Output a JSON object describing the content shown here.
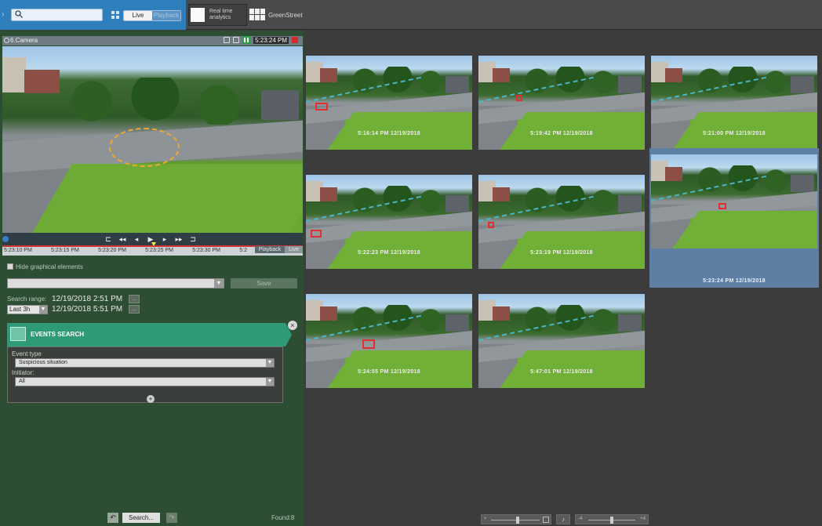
{
  "topbar": {
    "search_placeholder": "",
    "mode_live": "Live",
    "mode_playback": "Playback",
    "tab_realtime_line1": "Real time",
    "tab_realtime_line2": "analytics",
    "tab_greenstreet": "GreenStreet"
  },
  "camera": {
    "title": "6.Camera",
    "time": "5:23:24 PM"
  },
  "timeline": {
    "labels": [
      "5:23:10 PM",
      "5:23:15 PM",
      "5:23:20 PM",
      "5:23:25 PM",
      "5:23:30 PM",
      "5:2"
    ],
    "playback_label": "Playback",
    "live_label": "Live"
  },
  "controls": {
    "hide_graphical": "Hide graphical elements",
    "save": "Save",
    "search_range_label": "Search range:",
    "range_from": "12/19/2018 2:51 PM",
    "range_to": "12/19/2018 5:51 PM",
    "range_btn": "...",
    "last_option": "Last 3h"
  },
  "events_search": {
    "title": "EVENTS SEARCH",
    "event_type_label": "Event type",
    "event_type_value": "Suspicious situation",
    "initiator_label": "Initiator:",
    "initiator_value": "All"
  },
  "footer": {
    "search_button": "Search...",
    "found": "Found:8"
  },
  "results": [
    {
      "time": "5:16:14 PM 12/19/2018",
      "selected": false
    },
    {
      "time": "5:19:42 PM 12/19/2018",
      "selected": false
    },
    {
      "time": "5:21:00 PM 12/19/2018",
      "selected": false
    },
    {
      "time": "5:22:23 PM 12/19/2018",
      "selected": false
    },
    {
      "time": "5:23:19 PM 12/19/2018",
      "selected": false
    },
    {
      "time": "5:23:24 PM 12/19/2018",
      "selected": true
    },
    {
      "time": "5:24:55 PM 12/19/2018",
      "selected": false
    },
    {
      "time": "5:47:01 PM 12/19/2018",
      "selected": false
    }
  ],
  "bottom_controls": {
    "zoom_min": "+",
    "level_min": "-4",
    "level_max": "+4"
  },
  "colors": {
    "left_panel": "#2e4e34",
    "events_accent": "#2e9a78",
    "selected_border": "#5d7fa3",
    "topbar_blue": "#2f7fbd"
  }
}
